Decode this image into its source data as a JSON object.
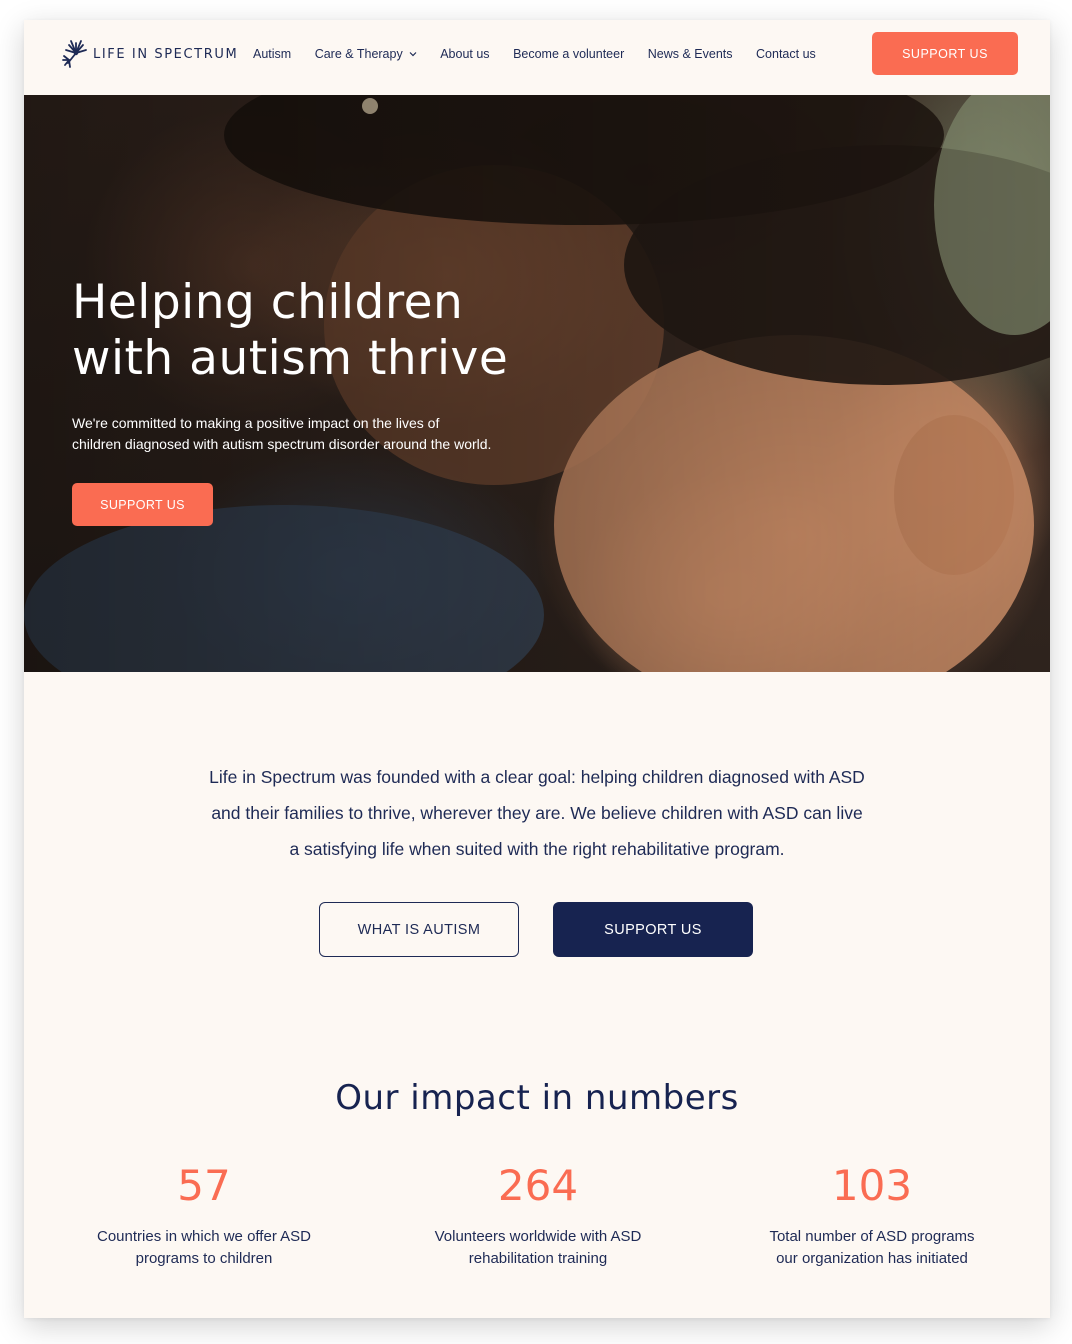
{
  "brand": {
    "name": "LIFE IN SPECTRUM",
    "logo_icon": "dandelion-logo-icon",
    "colors": {
      "accent": "#fa6c52",
      "navy": "#172350",
      "text": "#1e2a55",
      "background": "#fdf8f3"
    }
  },
  "nav": {
    "items": [
      {
        "label": "Autism"
      },
      {
        "label": "Care & Therapy",
        "has_dropdown": true
      },
      {
        "label": "About us"
      },
      {
        "label": "Become a volunteer"
      },
      {
        "label": "News & Events"
      },
      {
        "label": "Contact us"
      }
    ],
    "cta_label": "SUPPORT US"
  },
  "hero": {
    "title_line1": "Helping children",
    "title_line2": "with autism thrive",
    "subtitle_line1": "We're committed to making a positive impact on the lives of",
    "subtitle_line2": "children diagnosed with autism spectrum disorder around the world.",
    "cta_label": "SUPPORT US"
  },
  "intro": {
    "line1": "Life in Spectrum was founded with a clear goal: helping children diagnosed with ASD",
    "line2": "and their families to thrive, wherever they are. We believe children with ASD can live",
    "line3": "a satisfying life when suited with the right rehabilitative program.",
    "secondary_button": "WHAT IS AUTISM",
    "primary_button": "SUPPORT US"
  },
  "impact": {
    "title": "Our impact in numbers",
    "stats": [
      {
        "value": "57",
        "label_line1": "Countries in which we offer ASD",
        "label_line2": "programs to children"
      },
      {
        "value": "264",
        "label_line1": "Volunteers worldwide with ASD",
        "label_line2": "rehabilitation training"
      },
      {
        "value": "103",
        "label_line1": "Total number of ASD programs",
        "label_line2": "our organization has initiated"
      }
    ]
  }
}
